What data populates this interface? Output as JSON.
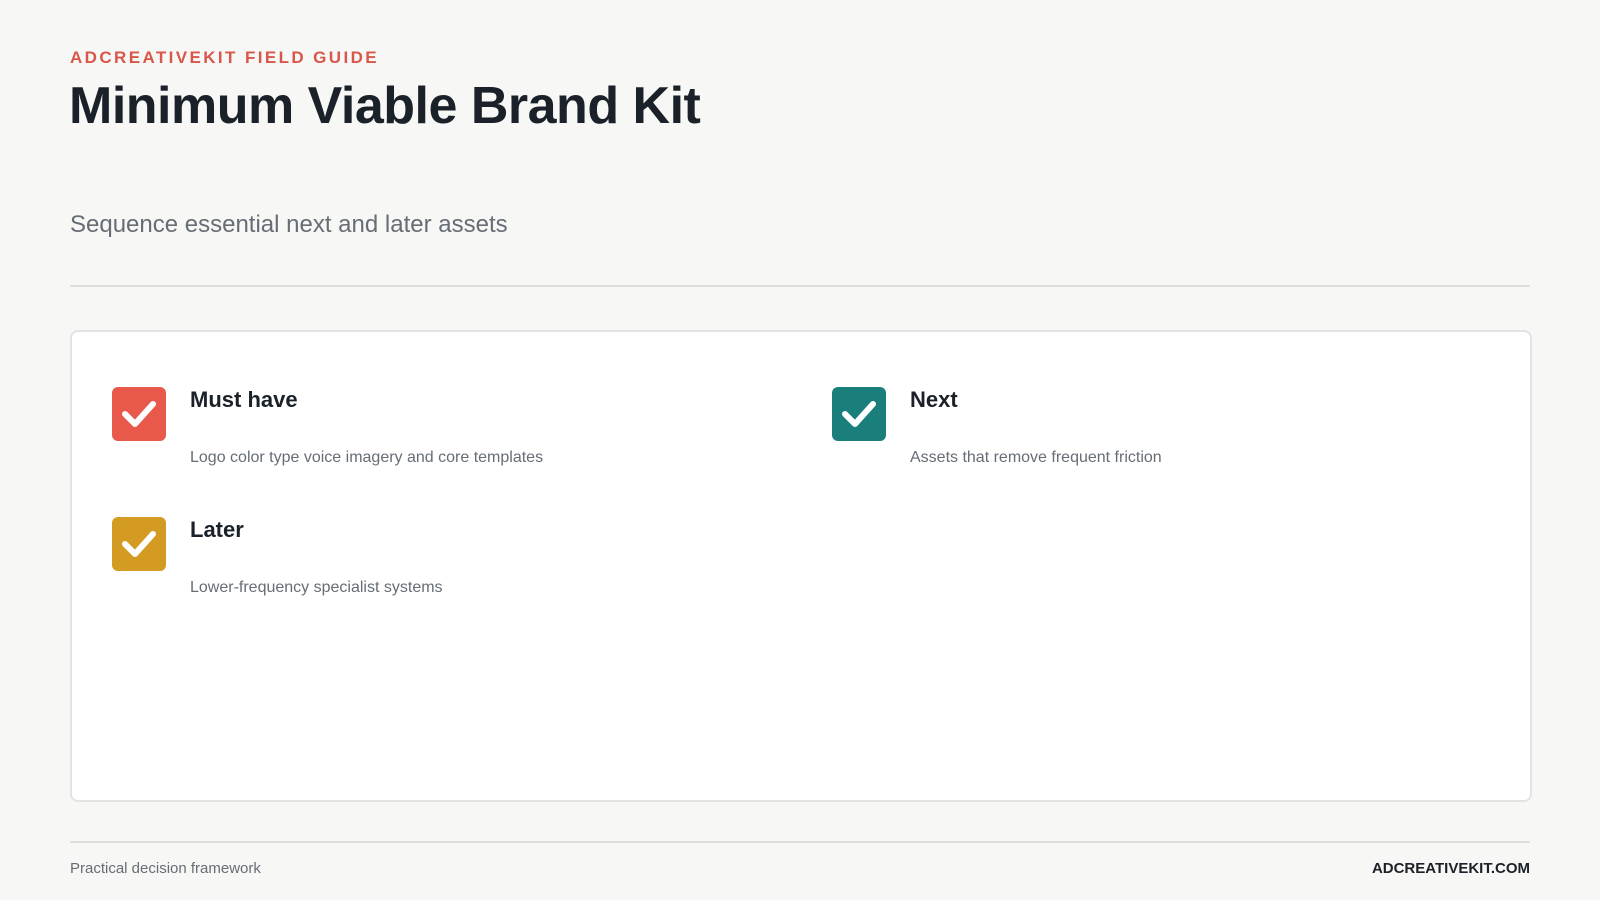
{
  "header": {
    "eyebrow": "ADCREATIVEKIT FIELD GUIDE",
    "title": "Minimum Viable Brand Kit",
    "subtitle": "Sequence essential next and later assets"
  },
  "items": [
    {
      "title": "Must have",
      "description": "Logo color type voice imagery and core templates",
      "color": "#e8594b",
      "icon": "checkmark-icon"
    },
    {
      "title": "Next",
      "description": "Assets that remove frequent friction",
      "color": "#1a7f7a",
      "icon": "checkmark-icon"
    },
    {
      "title": "Later",
      "description": "Lower-frequency specialist systems",
      "color": "#d49b23",
      "icon": "checkmark-icon"
    }
  ],
  "footer": {
    "left": "Practical decision framework",
    "right": "ADCREATIVEKIT.COM"
  },
  "colors": {
    "accent": "#d8574a",
    "text": "#1b2129",
    "muted": "#666d75",
    "background": "#f7f7f5"
  }
}
